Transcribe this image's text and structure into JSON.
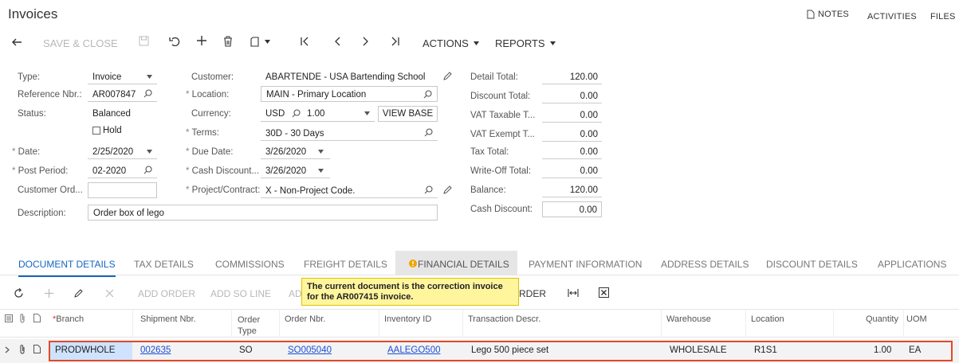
{
  "header": {
    "title": "Invoices",
    "notes": "NOTES",
    "activities": "ACTIVITIES",
    "files": "FILES"
  },
  "toolbar": {
    "save_close": "SAVE & CLOSE",
    "actions": "ACTIONS",
    "reports": "REPORTS"
  },
  "form": {
    "type_label": "Type:",
    "type_value": "Invoice",
    "refnbr_label": "Reference Nbr.:",
    "refnbr_value": "AR007847",
    "status_label": "Status:",
    "status_value": "Balanced",
    "hold_label": "Hold",
    "date_label": "Date:",
    "date_value": "2/25/2020",
    "postperiod_label": "Post Period:",
    "postperiod_value": "02-2020",
    "custord_label": "Customer Ord...",
    "custord_value": "",
    "desc_label": "Description:",
    "desc_value": "Order box of lego",
    "customer_label": "Customer:",
    "customer_value": "ABARTENDE - USA Bartending School",
    "location_label": "Location:",
    "location_value": "MAIN - Primary Location",
    "currency_label": "Currency:",
    "currency_value": "USD",
    "rate_value": "1.00",
    "view_base": "VIEW BASE",
    "terms_label": "Terms:",
    "terms_value": "30D - 30 Days",
    "duedate_label": "Due Date:",
    "duedate_value": "3/26/2020",
    "cashdisc_label": "Cash Discount...",
    "cashdisc_value": "3/26/2020",
    "project_label": "Project/Contract:",
    "project_value": "X - Non-Project Code.",
    "totals": [
      {
        "label": "Detail Total:",
        "value": "120.00"
      },
      {
        "label": "Discount Total:",
        "value": "0.00"
      },
      {
        "label": "VAT Taxable T...",
        "value": "0.00"
      },
      {
        "label": "VAT Exempt T...",
        "value": "0.00"
      },
      {
        "label": "Tax Total:",
        "value": "0.00"
      },
      {
        "label": "Write-Off Total:",
        "value": "0.00"
      },
      {
        "label": "Balance:",
        "value": "120.00"
      },
      {
        "label": "Cash Discount:",
        "value": "0.00"
      }
    ]
  },
  "tabs": [
    "DOCUMENT DETAILS",
    "TAX DETAILS",
    "COMMISSIONS",
    "FREIGHT DETAILS",
    "FINANCIAL DETAILS",
    "PAYMENT INFORMATION",
    "ADDRESS DETAILS",
    "DISCOUNT DETAILS",
    "APPLICATIONS"
  ],
  "grid_toolbar": {
    "add_order": "ADD ORDER",
    "add_so_line": "ADD SO LINE",
    "partial": "AD",
    "order_partial": "RDER"
  },
  "tooltip": {
    "line1": "The current document is the correction invoice",
    "line2": "for the AR007415 invoice."
  },
  "grid": {
    "columns": {
      "branch": "Branch",
      "shipment": "Shipment Nbr.",
      "order_type_1": "Order",
      "order_type_2": "Type",
      "order_nbr": "Order Nbr.",
      "inventory": "Inventory ID",
      "descr": "Transaction Descr.",
      "warehouse": "Warehouse",
      "location": "Location",
      "quantity": "Quantity",
      "uom": "UOM"
    },
    "row": {
      "branch": "PRODWHOLE",
      "shipment": "002635",
      "order_type": "SO",
      "order_nbr": "SO005040",
      "inventory": "AALEGO500",
      "descr": "Lego 500 piece set",
      "warehouse": "WHOLESALE",
      "location": "R1S1",
      "quantity": "1.00",
      "uom": "EA"
    }
  },
  "colors": {
    "accent": "#1565c0",
    "warning": "#f0a500",
    "tooltip_bg": "#fff59d",
    "row_highlight": "#e04a2a",
    "selected_cell": "#cfe3ff"
  }
}
